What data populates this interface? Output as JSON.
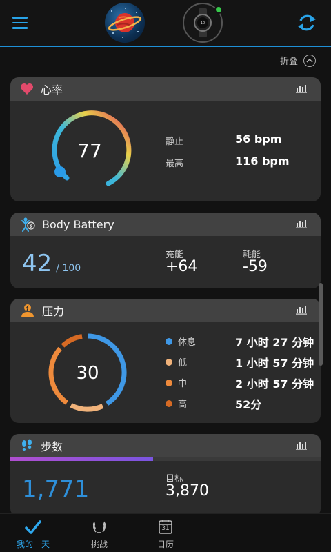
{
  "topbar": {
    "menu_icon": "hamburger-menu-icon",
    "avatar_icon": "planet-avatar-icon",
    "device_icon": "smartwatch-icon",
    "device_status_color": "#37c94b",
    "sync_icon": "sync-icon",
    "accent": "#29a3e8"
  },
  "collapse": {
    "label": "折叠"
  },
  "heart": {
    "title": "心率",
    "value": "77",
    "rows": [
      {
        "label": "静止",
        "value": "56 bpm"
      },
      {
        "label": "最高",
        "value": "116 bpm"
      }
    ]
  },
  "battery": {
    "title": "Body Battery",
    "value": "42",
    "suffix": "/ 100",
    "charged_label": "充能",
    "charged_value": "+64",
    "drained_label": "耗能",
    "drained_value": "-59"
  },
  "stress": {
    "title": "压力",
    "value": "30",
    "rows": [
      {
        "label": "休息",
        "value": "7 小时 27 分钟",
        "color": "#3f98e6"
      },
      {
        "label": "低",
        "value": "1 小时 57 分钟",
        "color": "#f0b27a"
      },
      {
        "label": "中",
        "value": "2 小时 57 分钟",
        "color": "#ee8a3c"
      },
      {
        "label": "高",
        "value": "52分",
        "color": "#d66a24"
      }
    ]
  },
  "steps": {
    "title": "步数",
    "value": "1,771",
    "goal_label": "目标",
    "goal_value": "3,870",
    "progress": 0.46
  },
  "nav": {
    "items": [
      {
        "label": "我的一天",
        "icon": "checkmark-icon"
      },
      {
        "label": "挑战",
        "icon": "laurel-icon"
      },
      {
        "label": "日历",
        "icon": "calendar-icon",
        "day": "31"
      }
    ]
  }
}
